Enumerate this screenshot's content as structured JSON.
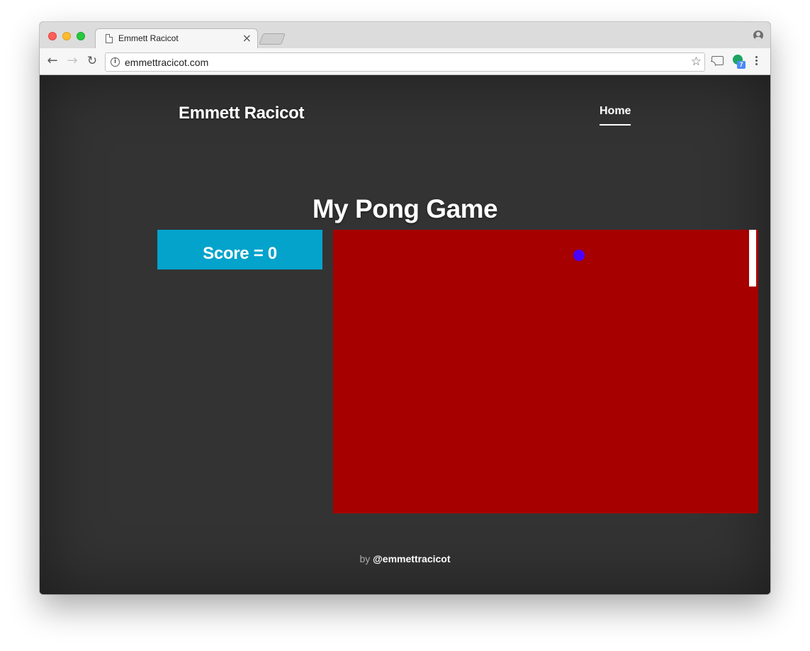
{
  "browser": {
    "tab": {
      "title": "Emmett Racicot",
      "close_glyph": "×"
    },
    "toolbar": {
      "back_glyph": "←",
      "forward_glyph": "→",
      "reload_glyph": "↻",
      "url": "emmettracicot.com",
      "info_glyph": "i",
      "star_glyph": "☆",
      "extension_badge": "7"
    },
    "icons": {
      "page": "page-icon",
      "profile": "profile-icon",
      "cast": "cast-icon",
      "menu": "menu-icon"
    }
  },
  "site": {
    "title": "Emmett Racicot",
    "nav": {
      "home_label": "Home"
    }
  },
  "main": {
    "heading": "My Pong Game",
    "score_label": "Score = 0",
    "game": {
      "background_color": "#a60000",
      "ball_color": "#4a00ff",
      "paddle_color": "#ffffff"
    }
  },
  "footer": {
    "by": "by",
    "handle": "@emmettracicot"
  },
  "colors": {
    "page_background": "#333333",
    "score_background": "#03a3cb"
  }
}
